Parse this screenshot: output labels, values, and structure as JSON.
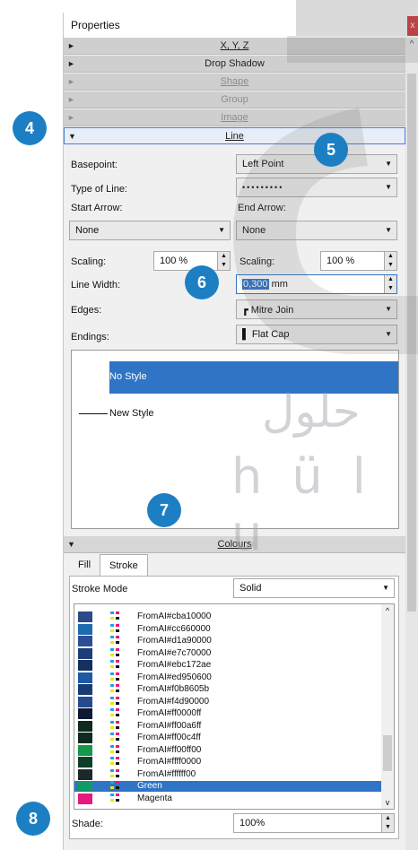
{
  "window": {
    "title": "Properties",
    "close_glyph": "x"
  },
  "sections": [
    {
      "label": "X, Y, Z",
      "disabled": false
    },
    {
      "label": "Drop Shadow",
      "disabled": false
    },
    {
      "label": "Shape",
      "disabled": true
    },
    {
      "label": "Group",
      "disabled": true
    },
    {
      "label": "Image",
      "disabled": true
    },
    {
      "label": "Line",
      "disabled": false,
      "expanded": true
    }
  ],
  "line": {
    "basepoint_label": "Basepoint:",
    "basepoint_value": "Left Point",
    "type_label": "Type of Line:",
    "type_value": "•••••••••",
    "start_arrow_label": "Start Arrow:",
    "end_arrow_label": "End Arrow:",
    "start_arrow_value": "None",
    "end_arrow_value": "None",
    "scaling_label": "Scaling:",
    "scaling_left": "100 %",
    "scaling_right_label": "Scaling:",
    "scaling_right": "100 %",
    "width_label": "Line Width:",
    "width_value": "0,300",
    "width_unit": "mm",
    "edges_label": "Edges:",
    "edges_value": "Mitre Join",
    "endings_label": "Endings:",
    "endings_value": "Flat Cap",
    "styles": [
      "No Style",
      "New Style"
    ]
  },
  "colours": {
    "section_label": "Colours",
    "tabs": [
      "Fill",
      "Stroke"
    ],
    "active_tab": "Stroke",
    "stroke_mode_label": "Stroke Mode",
    "stroke_mode_value": "Solid",
    "items": [
      {
        "name": "FromAI#cba10000",
        "color": "#2a4a8a"
      },
      {
        "name": "FromAI#cc660000",
        "color": "#1f6bb0"
      },
      {
        "name": "FromAI#d1a90000",
        "color": "#2a4f94"
      },
      {
        "name": "FromAI#e7c70000",
        "color": "#1c3e78"
      },
      {
        "name": "FromAI#ebc172ae",
        "color": "#15305f"
      },
      {
        "name": "FromAI#ed950600",
        "color": "#1d5aa3"
      },
      {
        "name": "FromAI#f0b8605b",
        "color": "#173d72"
      },
      {
        "name": "FromAI#f4d90000",
        "color": "#244b8e"
      },
      {
        "name": "FromAI#ff0000ff",
        "color": "#0d1a33"
      },
      {
        "name": "FromAI#ff00a6ff",
        "color": "#102a1c"
      },
      {
        "name": "FromAI#ff00c4ff",
        "color": "#0f2a20"
      },
      {
        "name": "FromAI#ff00ff00",
        "color": "#129a4a"
      },
      {
        "name": "FromAI#ffff0000",
        "color": "#0e3d2a"
      },
      {
        "name": "FromAI#ffffff00",
        "color": "#1a2a2a"
      },
      {
        "name": "Green",
        "color": "#0f9a6a",
        "selected": true
      },
      {
        "name": "Magenta",
        "color": "#e6197f"
      }
    ],
    "shade_label": "Shade:",
    "shade_value": "100%"
  },
  "callouts": [
    "4",
    "5",
    "6",
    "7",
    "8"
  ],
  "watermark": {
    "arabic": "حلول",
    "latin": "h ü l u"
  },
  "accent": "#1d7fc3"
}
